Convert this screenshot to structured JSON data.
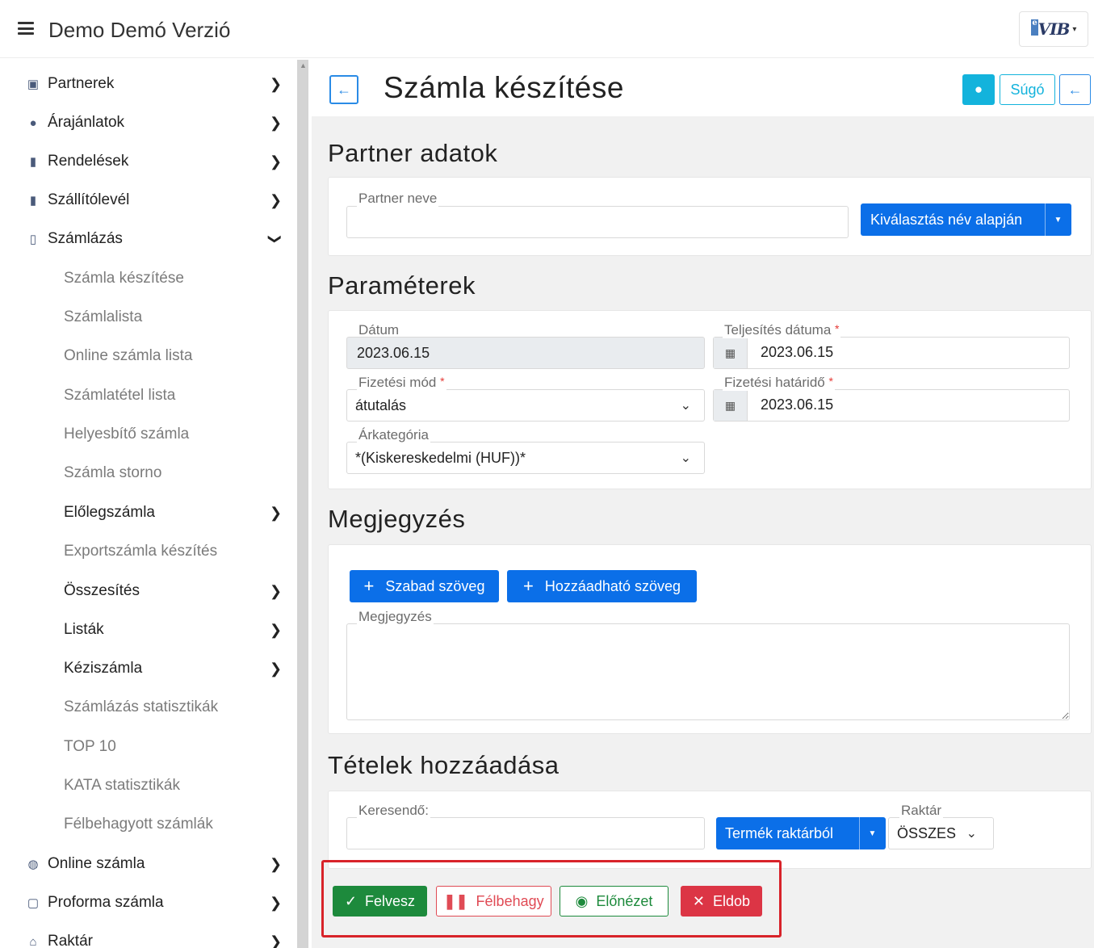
{
  "app": {
    "title": "Demo Demó Verzió",
    "logo_text": "VIB"
  },
  "sidebar": {
    "items": [
      {
        "label": "Partnerek",
        "icon": "address-card-icon"
      },
      {
        "label": "Árajánlatok",
        "icon": "comments-icon"
      },
      {
        "label": "Rendelések",
        "icon": "file-icon"
      },
      {
        "label": "Szállítólevél",
        "icon": "clipboard-icon"
      },
      {
        "label": "Számlázás",
        "icon": "invoice-icon"
      },
      {
        "label": "Számla készítése"
      },
      {
        "label": "Számlalista"
      },
      {
        "label": "Online számla lista"
      },
      {
        "label": "Számlatétel lista"
      },
      {
        "label": "Helyesbítő számla"
      },
      {
        "label": "Számla storno"
      },
      {
        "label": "Előlegszámla"
      },
      {
        "label": "Exportszámla készítés"
      },
      {
        "label": "Összesítés"
      },
      {
        "label": "Listák"
      },
      {
        "label": "Kéziszámla"
      },
      {
        "label": "Számlázás statisztikák"
      },
      {
        "label": "TOP 10"
      },
      {
        "label": "KATA statisztikák"
      },
      {
        "label": "Félbehagyott számlák"
      },
      {
        "label": "Online számla",
        "icon": "globe-icon"
      },
      {
        "label": "Proforma számla",
        "icon": "square-icon"
      },
      {
        "label": "Raktár",
        "icon": "warehouse-icon"
      }
    ]
  },
  "header": {
    "title": "Számla készítése",
    "help_label": "Súgó"
  },
  "partner": {
    "section_title": "Partner adatok",
    "name_label": "Partner neve",
    "name_value": "",
    "select_button": "Kiválasztás név alapján"
  },
  "params": {
    "section_title": "Paraméterek",
    "date_label": "Dátum",
    "date_value": "2023.06.15",
    "fulfil_label": "Teljesítés dátuma",
    "fulfil_value": "2023.06.15",
    "payment_label": "Fizetési mód",
    "payment_value": "átutalás",
    "deadline_label": "Fizetési határidő",
    "deadline_value": "2023.06.15",
    "price_cat_label": "Árkategória",
    "price_cat_value": "*(Kiskereskedelmi (HUF))*",
    "required_mark": "*"
  },
  "note": {
    "section_title": "Megjegyzés",
    "free_text_button": "Szabad szöveg",
    "addable_text_button": "Hozzáadható szöveg",
    "field_label": "Megjegyzés",
    "value": ""
  },
  "items": {
    "section_title": "Tételek hozzáadása",
    "search_label": "Keresendő:",
    "search_value": "",
    "product_button": "Termék raktárból",
    "warehouse_label": "Raktár",
    "warehouse_value": "ÖSSZES"
  },
  "actions": {
    "save": "Felvesz",
    "pause": "Félbehagy",
    "preview": "Előnézet",
    "discard": "Eldob"
  },
  "colors": {
    "primary": "#0b6fe8",
    "info": "#13b3dc",
    "success": "#1d8a3c",
    "danger": "#dc3545",
    "highlight": "#d8232a"
  }
}
